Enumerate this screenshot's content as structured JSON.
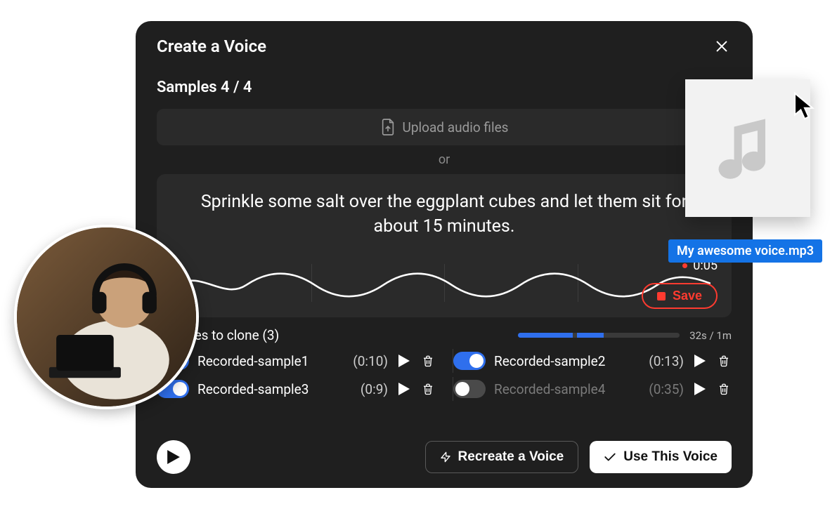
{
  "modal": {
    "title": "Create a Voice",
    "samples_label": "Samples 4 / 4",
    "upload_label": "Upload audio files",
    "or_label": "or",
    "prompt_text": "Sprinkle some salt over the eggplant cubes and let them sit for about 15 minutes.",
    "rec_time": "0:05",
    "save_label": "Save"
  },
  "clone": {
    "heading": "Samples to clone (3)",
    "progress_label": "32s / 1m",
    "progress_pct": 53,
    "samples": [
      {
        "name": "Recorded-sample1",
        "duration": "(0:10)",
        "enabled": true
      },
      {
        "name": "Recorded-sample2",
        "duration": "(0:13)",
        "enabled": true
      },
      {
        "name": "Recorded-sample3",
        "duration": "(0:9)",
        "enabled": true
      },
      {
        "name": "Recorded-sample4",
        "duration": "(0:35)",
        "enabled": false
      }
    ]
  },
  "footer": {
    "recreate_label": "Recreate a Voice",
    "use_label": "Use This Voice"
  },
  "overlay": {
    "file_name": "My awesome voice.mp3"
  }
}
